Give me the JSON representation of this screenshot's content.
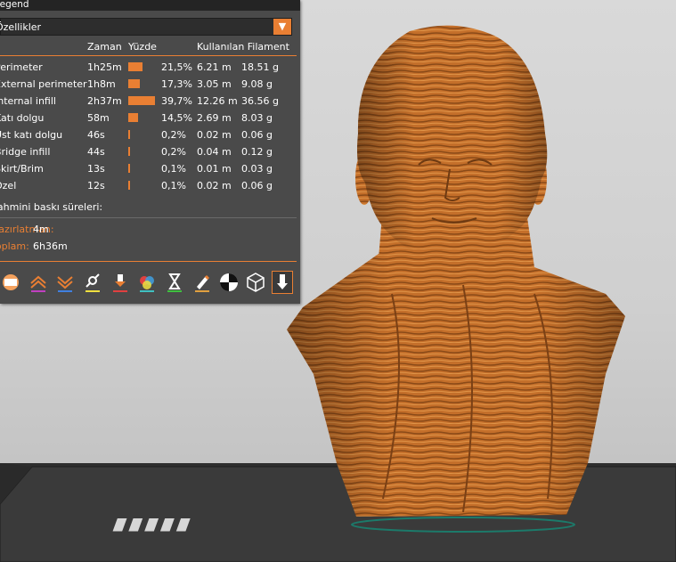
{
  "legend": {
    "title": "Legend",
    "view_selected": "Özellikler",
    "headers": {
      "name": "",
      "time": "Zaman",
      "percent": "Yüzde",
      "used_filament": "Kullanılan Filament"
    },
    "rows": [
      {
        "name": "Perimeter",
        "time": "1h25m",
        "percent": "21,5%",
        "length": "6.21 m",
        "weight": "18.51 g",
        "fraction": 0.215
      },
      {
        "name": "External perimeter",
        "time": "1h8m",
        "percent": "17,3%",
        "length": "3.05 m",
        "weight": "9.08 g",
        "fraction": 0.173
      },
      {
        "name": "Internal infill",
        "time": "2h37m",
        "percent": "39,7%",
        "length": "12.26 m",
        "weight": "36.56 g",
        "fraction": 0.397
      },
      {
        "name": "Katı dolgu",
        "time": "58m",
        "percent": "14,5%",
        "length": "2.69 m",
        "weight": "8.03 g",
        "fraction": 0.145
      },
      {
        "name": "Üst katı dolgu",
        "time": "46s",
        "percent": "0,2%",
        "length": "0.02 m",
        "weight": "0.06 g",
        "fraction": 0.002
      },
      {
        "name": "Bridge infill",
        "time": "44s",
        "percent": "0,2%",
        "length": "0.04 m",
        "weight": "0.12 g",
        "fraction": 0.002
      },
      {
        "name": "Skirt/Brim",
        "time": "13s",
        "percent": "0,1%",
        "length": "0.01 m",
        "weight": "0.03 g",
        "fraction": 0.001
      },
      {
        "name": "Özel",
        "time": "12s",
        "percent": "0,1%",
        "length": "0.02 m",
        "weight": "0.06 g",
        "fraction": 0.001
      }
    ],
    "estimated_label": "Tahmini baskı süreleri:",
    "modes": [
      {
        "key": "Hazırlatman:",
        "value": "4m"
      },
      {
        "key": "Toplam:",
        "value": "6h36m"
      }
    ]
  },
  "toolbar": {
    "icons": [
      "travel-icon",
      "retractions-icon",
      "deretractions-icon",
      "wipe-icon",
      "seams-icon",
      "color-changes-icon",
      "pause-prints-icon",
      "custom-gcode-icon",
      "center-of-gravity-icon",
      "shells-icon",
      "toolpath-marker-icon"
    ]
  },
  "colors": {
    "accent": "#e97f33",
    "panel": "#4a4a4a",
    "model_main": "#c8732d",
    "model_dark": "#8a4a18",
    "bed": "#3a3a3a"
  }
}
